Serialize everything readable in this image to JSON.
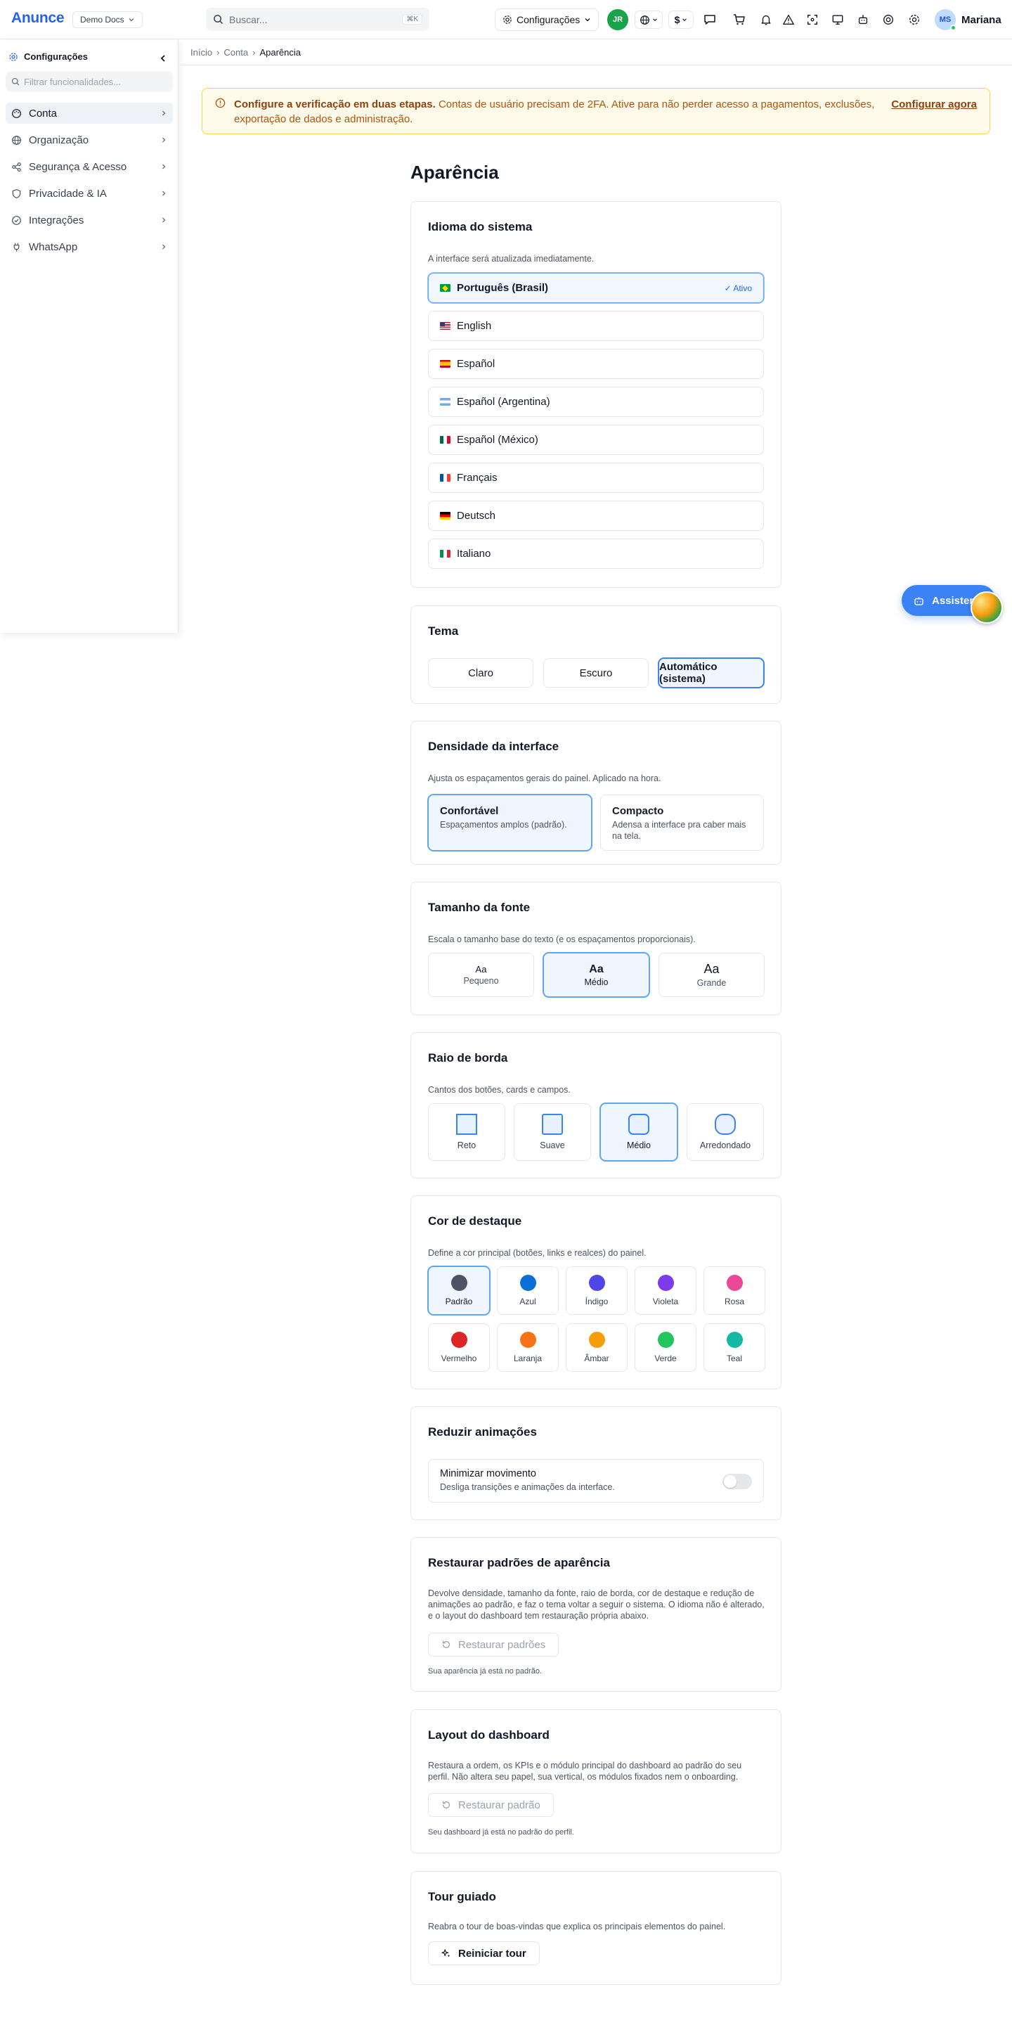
{
  "app": {
    "brand": "Anunce",
    "workspace": "Demo Docs"
  },
  "topbar": {
    "search_placeholder": "Buscar...",
    "search_shortcut": "⌘K",
    "config_label": "Configurações",
    "user_initials_jr": "JR",
    "currency_label": "$",
    "user_initials": "MS",
    "user_name": "Mariana"
  },
  "sidebar": {
    "title": "Configurações",
    "filter_placeholder": "Filtrar funcionalidades...",
    "items": [
      {
        "label": "Conta",
        "icon": "palette-icon"
      },
      {
        "label": "Organização",
        "icon": "globe-icon"
      },
      {
        "label": "Segurança & Acesso",
        "icon": "share-icon"
      },
      {
        "label": "Privacidade & IA",
        "icon": "shield-icon"
      },
      {
        "label": "Integrações",
        "icon": "check-circle-icon"
      },
      {
        "label": "WhatsApp",
        "icon": "plug-icon"
      }
    ]
  },
  "breadcrumb": [
    "Início",
    "Conta",
    "Aparência"
  ],
  "alert": {
    "title": "Configure a verificação em duas etapas.",
    "body": "Contas de usuário precisam de 2FA. Ative para não perder acesso a pagamentos, exclusões, exportação de dados e administração.",
    "link": "Configurar agora"
  },
  "page_title": "Aparência",
  "language": {
    "title": "Idioma do sistema",
    "description": "A interface será atualizada imediatamente.",
    "active_badge": "✓ Ativo",
    "options": [
      {
        "label": "Português (Brasil)",
        "selected": true
      },
      {
        "label": "English"
      },
      {
        "label": "Español"
      },
      {
        "label": "Español (Argentina)"
      },
      {
        "label": "Español (México)"
      },
      {
        "label": "Français"
      },
      {
        "label": "Deutsch"
      },
      {
        "label": "Italiano"
      }
    ]
  },
  "theme": {
    "title": "Tema",
    "options": [
      "Claro",
      "Escuro",
      "Automático (sistema)"
    ],
    "selected": "Automático (sistema)"
  },
  "density": {
    "title": "Densidade da interface",
    "description": "Ajusta os espaçamentos gerais do painel. Aplicado na hora.",
    "options": [
      {
        "title": "Confortável",
        "desc": "Espaçamentos amplos (padrão).",
        "selected": true
      },
      {
        "title": "Compacto",
        "desc": "Adensa a interface pra caber mais na tela."
      }
    ]
  },
  "font_size": {
    "title": "Tamanho da fonte",
    "description": "Escala o tamanho base do texto (e os espaçamentos proporcionais).",
    "sample": "Aa",
    "options": [
      "Pequeno",
      "Médio",
      "Grande"
    ],
    "selected": "Médio"
  },
  "radius": {
    "title": "Raio de borda",
    "description": "Cantos dos botões, cards e campos.",
    "options": [
      "Reto",
      "Suave",
      "Médio",
      "Arredondado"
    ],
    "selected": "Médio"
  },
  "accent": {
    "title": "Cor de destaque",
    "description": "Define a cor principal (botões, links e realces) do painel.",
    "selected": "Padrão",
    "options": [
      {
        "label": "Padrão",
        "color": "#4b5563"
      },
      {
        "label": "Azul",
        "color": "#0b6fd6"
      },
      {
        "label": "Índigo",
        "color": "#4f46e5"
      },
      {
        "label": "Violeta",
        "color": "#7c3aed"
      },
      {
        "label": "Rosa",
        "color": "#ec4899"
      },
      {
        "label": "Vermelho",
        "color": "#dc2626"
      },
      {
        "label": "Laranja",
        "color": "#f97316"
      },
      {
        "label": "Âmbar",
        "color": "#f59e0b"
      },
      {
        "label": "Verde",
        "color": "#22c55e"
      },
      {
        "label": "Teal",
        "color": "#14b8a6"
      }
    ]
  },
  "motion": {
    "title": "Reduzir animações",
    "option_title": "Minimizar movimento",
    "option_desc": "Desliga transições e animações da interface.",
    "enabled": false
  },
  "restore_appearance": {
    "title": "Restaurar padrões de aparência",
    "description": "Devolve densidade, tamanho da fonte, raio de borda, cor de destaque e redução de animações ao padrão, e faz o tema voltar a seguir o sistema. O idioma não é alterado, e o layout do dashboard tem restauração própria abaixo.",
    "button": "Restaurar padrões",
    "hint": "Sua aparência já está no padrão."
  },
  "dashboard_layout": {
    "title": "Layout do dashboard",
    "description": "Restaura a ordem, os KPIs e o módulo principal do dashboard ao padrão do seu perfil. Não altera seu papel, sua vertical, os módulos fixados nem o onboarding.",
    "button": "Restaurar padrão",
    "hint": "Seu dashboard já está no padrão do perfil."
  },
  "tour": {
    "title": "Tour guiado",
    "description": "Reabra o tour de boas-vindas que explica os principais elementos do painel.",
    "button": "Reiniciar tour"
  },
  "assistant": {
    "label": "Assistente"
  }
}
